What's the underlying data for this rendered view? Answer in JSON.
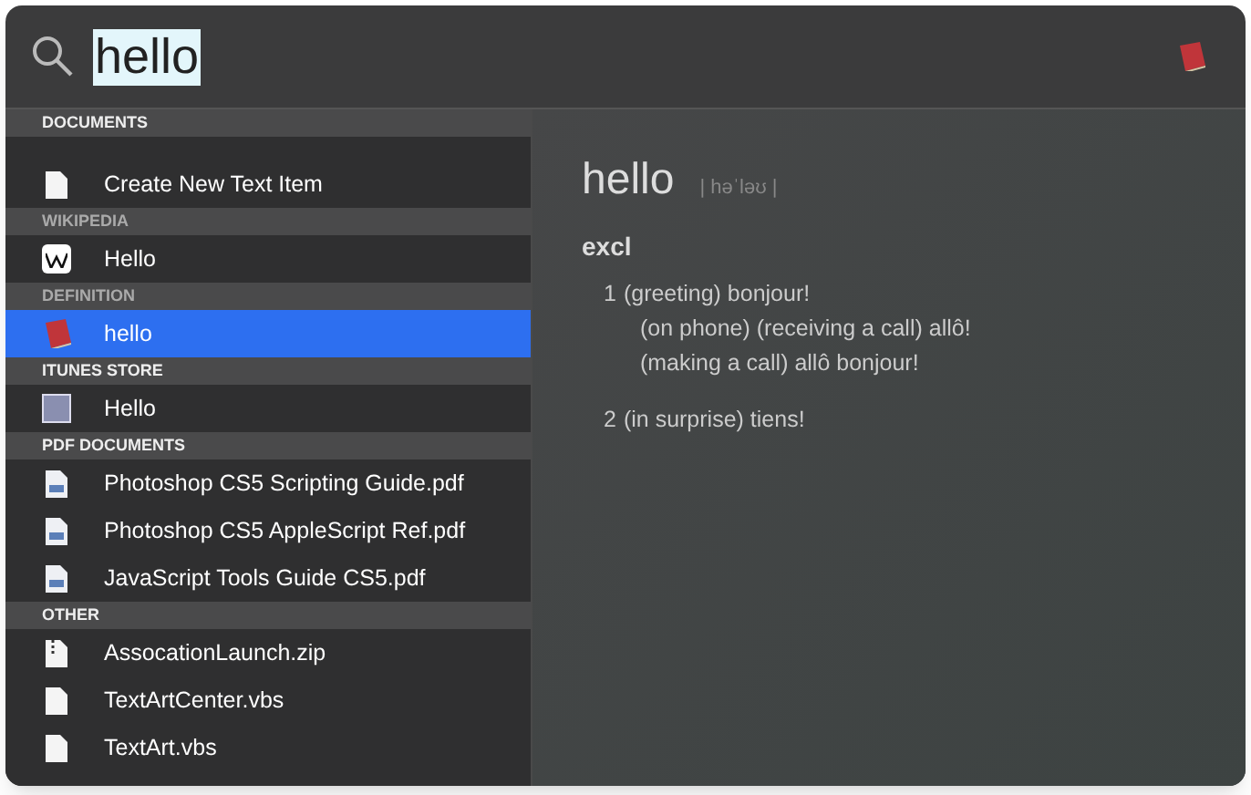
{
  "search": {
    "value": "hello"
  },
  "sections": [
    {
      "title": "DOCUMENTS",
      "items": [
        {
          "kind": "doc",
          "label": "Create New Text Item",
          "selected": false
        }
      ]
    },
    {
      "title": "WIKIPEDIA",
      "items": [
        {
          "kind": "wiki",
          "label": "Hello",
          "selected": false
        }
      ]
    },
    {
      "title": "DEFINITION",
      "items": [
        {
          "kind": "dict",
          "label": "hello",
          "selected": true
        }
      ]
    },
    {
      "title": "ITUNES STORE",
      "items": [
        {
          "kind": "artwork",
          "label": "Hello",
          "selected": false
        }
      ]
    },
    {
      "title": "PDF DOCUMENTS",
      "items": [
        {
          "kind": "pdf",
          "label": "Photoshop CS5 Scripting Guide.pdf",
          "selected": false
        },
        {
          "kind": "pdf",
          "label": "Photoshop CS5 AppleScript Ref.pdf",
          "selected": false
        },
        {
          "kind": "pdf",
          "label": "JavaScript Tools Guide CS5.pdf",
          "selected": false
        }
      ]
    },
    {
      "title": "OTHER",
      "items": [
        {
          "kind": "zip",
          "label": "AssocationLaunch.zip",
          "selected": false
        },
        {
          "kind": "doc",
          "label": "TextArtCenter.vbs",
          "selected": false
        },
        {
          "kind": "doc",
          "label": "TextArt.vbs",
          "selected": false
        }
      ]
    }
  ],
  "definition": {
    "word": "hello",
    "pronunciation": "| həˈləʊ |",
    "part_of_speech": "excl",
    "senses": [
      {
        "number": "1",
        "lines": [
          "(greeting)  bonjour!",
          "(on phone)  (receiving a call)  allô!",
          "(making a call)  allô bonjour!"
        ]
      },
      {
        "number": "2",
        "lines": [
          "(in surprise)  tiens!"
        ]
      }
    ]
  }
}
